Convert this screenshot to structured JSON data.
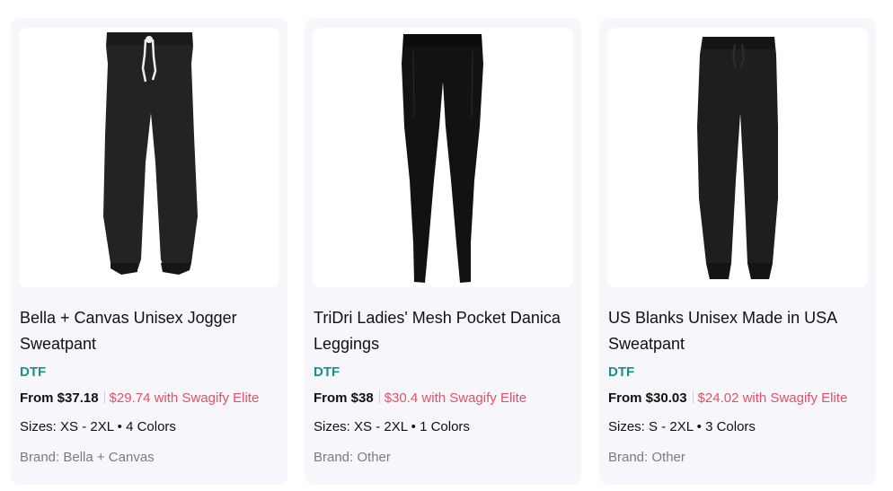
{
  "products": [
    {
      "image_alt": "black-jogger-sweatpant",
      "title": "Bella + Canvas Unisex Jogger Sweatpant",
      "tag": "DTF",
      "price": "From $37.18",
      "elite_price": "$29.74 with Swagify Elite",
      "sizes": "Sizes: XS - 2XL • 4 Colors",
      "brand": "Brand: Bella + Canvas"
    },
    {
      "image_alt": "black-leggings",
      "title": "TriDri Ladies' Mesh Pocket Danica Leggings",
      "tag": "DTF",
      "price": "From $38",
      "elite_price": "$30.4 with Swagify Elite",
      "sizes": "Sizes: XS - 2XL • 1 Colors",
      "brand": "Brand: Other"
    },
    {
      "image_alt": "black-sweatpant",
      "title": "US Blanks Unisex Made in USA Sweatpant",
      "tag": "DTF",
      "price": "From $30.03",
      "elite_price": "$24.02 with Swagify Elite",
      "sizes": "Sizes: S - 2XL • 3 Colors",
      "brand": "Brand: Other"
    }
  ],
  "colors": {
    "card_bg": "#f6f6fb",
    "tag": "#1c8f86",
    "elite": "#e0526b",
    "brand": "#7a7a80"
  }
}
